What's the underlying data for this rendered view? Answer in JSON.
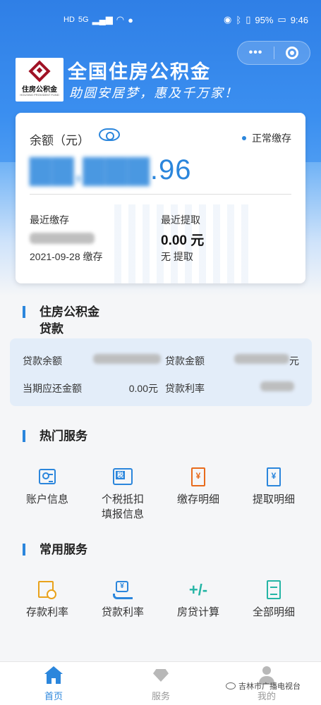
{
  "status_bar": {
    "left_icons": [
      "HD",
      "5G",
      "signal-icon",
      "wifi-icon",
      "message-icon"
    ],
    "battery": "95%",
    "time": "9:46"
  },
  "header": {
    "logo_text": "住房公积金",
    "logo_subtext": "HOUSING PROVIDENT FUND",
    "title": "全国住房公积金",
    "slogan": "助圆安居梦，惠及千万家！",
    "menu_glyph": "•••"
  },
  "balance_card": {
    "label": "余额（元）",
    "status": "正常缴存",
    "amount_visible": ".96",
    "recent_deposit_label": "最近缴存",
    "recent_deposit_date": "2021-09-28 缴存",
    "recent_withdraw_label": "最近提取",
    "recent_withdraw_value": "0.00 元",
    "recent_withdraw_sub": "无 提取"
  },
  "loan_section": {
    "title_line1": "住房公积金",
    "title_line2": "贷款",
    "row1_label_left": "贷款余额",
    "row1_label_right": "贷款金额",
    "row1_right_unit": "元",
    "row2_label_left": "当期应还金额",
    "row2_value_left": "0.00元",
    "row2_label_right": "贷款利率"
  },
  "hot_services": {
    "title": "热门服务",
    "items": [
      {
        "line1": "账户信息",
        "line2": ""
      },
      {
        "line1": "个税抵扣",
        "line2": "填报信息"
      },
      {
        "line1": "缴存明细",
        "line2": ""
      },
      {
        "line1": "提取明细",
        "line2": ""
      }
    ],
    "icon_glyphs": {
      "tax": "税",
      "deposit": "¥",
      "withdraw": "¥"
    }
  },
  "common_services": {
    "title": "常用服务",
    "items": [
      {
        "line1": "存款利率"
      },
      {
        "line1": "贷款利率"
      },
      {
        "line1": "房贷计算"
      },
      {
        "line1": "全部明细"
      }
    ],
    "icon_glyphs": {
      "loan": "¥",
      "calc": "+/-"
    }
  },
  "bottom_nav": {
    "items": [
      "首页",
      "服务",
      "我的"
    ],
    "active": "首页",
    "active_color": "#2b86dc",
    "inactive_color": "#999999"
  },
  "watermark": "吉林市广播电视台"
}
